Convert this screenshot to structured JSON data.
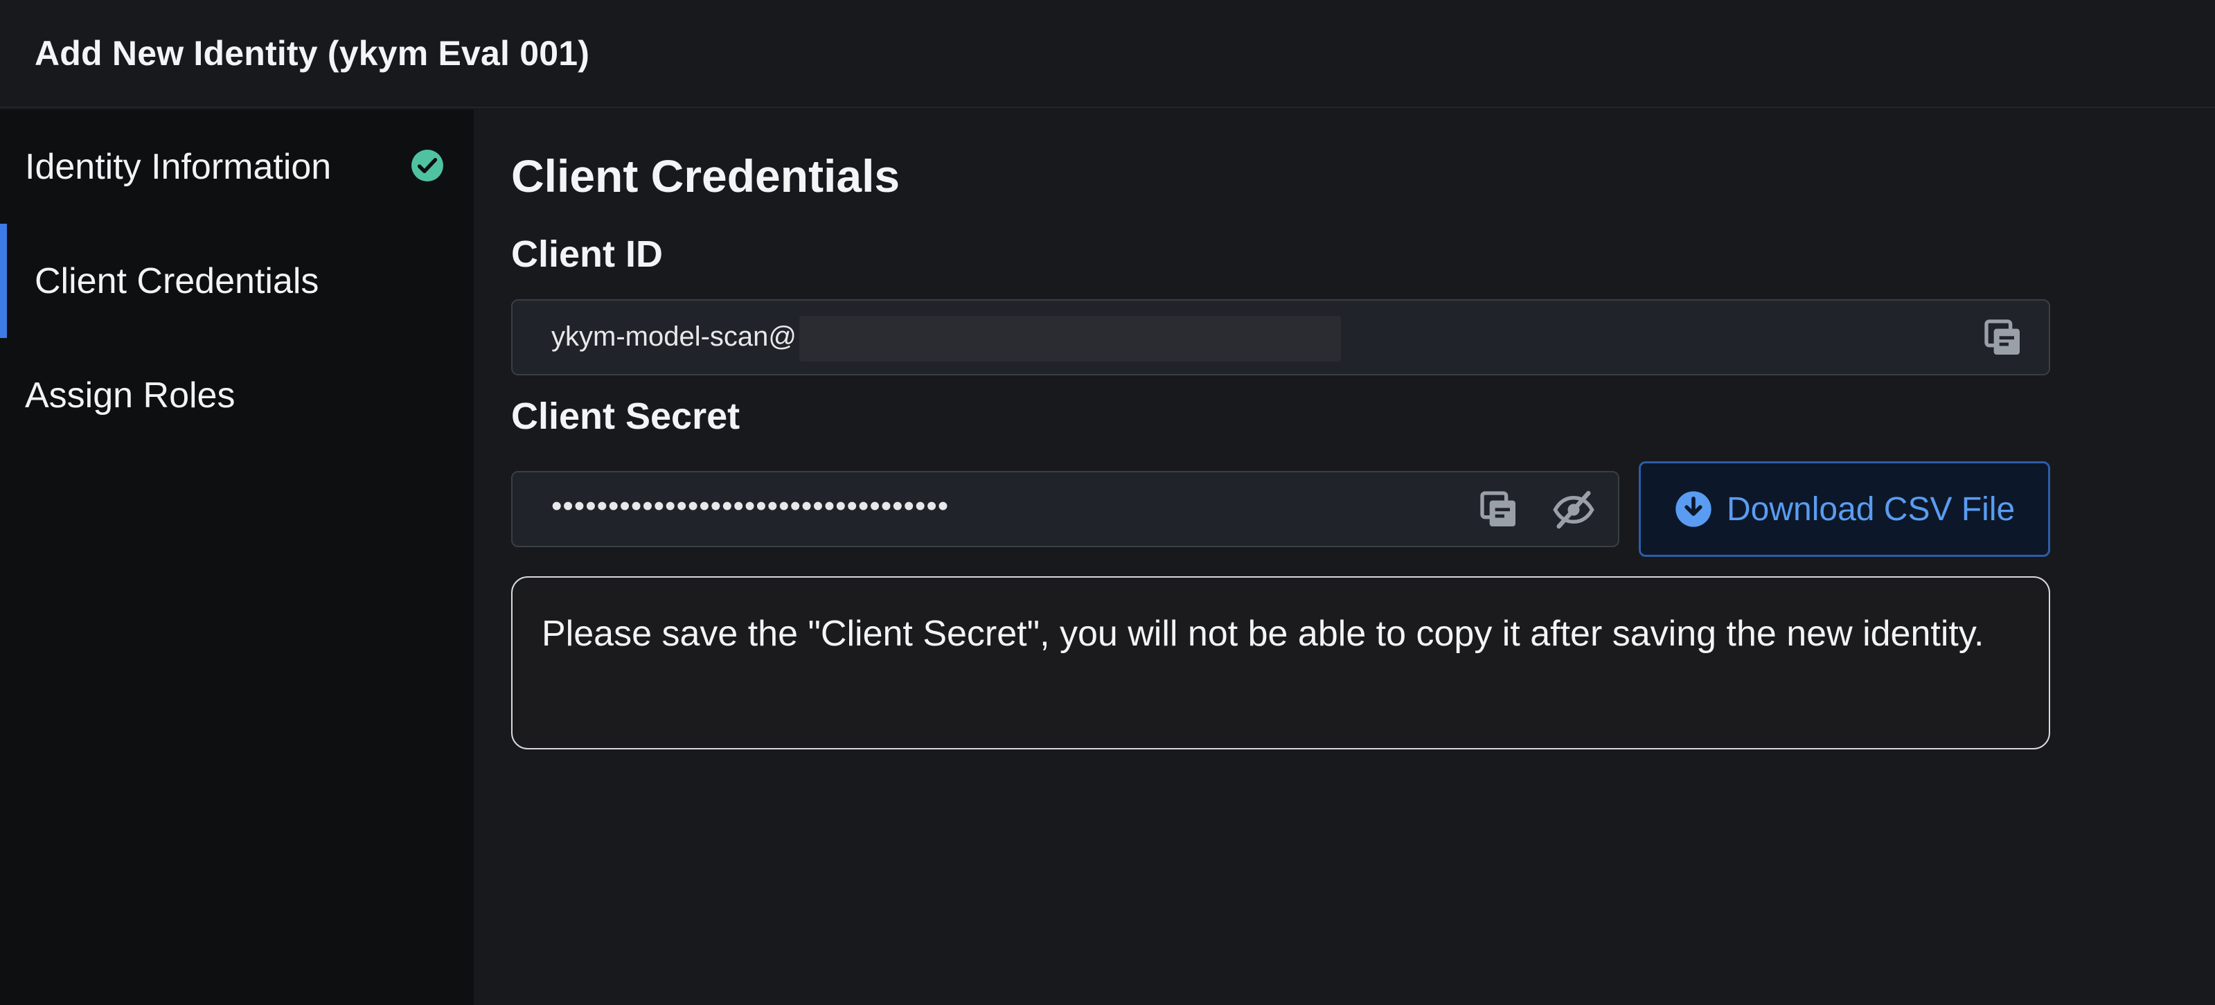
{
  "header": {
    "title": "Add New Identity (ykym Eval 001)"
  },
  "sidebar": {
    "items": [
      {
        "label": "Identity Information",
        "status_icon": "check-circle-icon",
        "status_color": "#4fc3a1"
      },
      {
        "label": "Client Credentials",
        "active": true,
        "accent_color": "#3d7be6"
      },
      {
        "label": "Assign Roles"
      }
    ]
  },
  "main": {
    "title": "Client Credentials",
    "client_id": {
      "label": "Client ID",
      "value": "ykym-model-scan@",
      "copy_icon": "copy-icon"
    },
    "client_secret": {
      "label": "Client Secret",
      "value": "•••••••••••••••••••••••••••••••••••",
      "copy_icon": "copy-icon",
      "visibility_icon": "eye-off-icon"
    },
    "download_button": {
      "label": "Download CSV File",
      "icon": "download-circle-icon",
      "color": "#5a9cf2"
    },
    "notice": "Please save the \"Client Secret\", you will not be able to copy it after saving the new identity."
  }
}
